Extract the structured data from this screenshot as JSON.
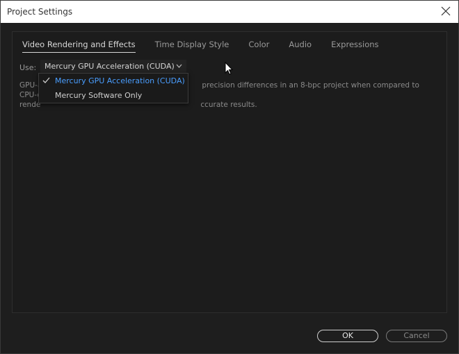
{
  "window": {
    "title": "Project Settings"
  },
  "tabs": [
    {
      "label": "Video Rendering and Effects",
      "active": true
    },
    {
      "label": "Time Display Style",
      "active": false
    },
    {
      "label": "Color",
      "active": false
    },
    {
      "label": "Audio",
      "active": false
    },
    {
      "label": "Expressions",
      "active": false
    }
  ],
  "renderer": {
    "use_label": "Use:",
    "selected": "Mercury GPU Acceleration (CUDA)",
    "options": [
      "Mercury GPU Acceleration (CUDA)",
      "Mercury Software Only"
    ],
    "description_line1_start": "GPU-a",
    "description_line1_end": "precision differences in an 8-bpc project when compared to CPU-only",
    "description_line2_start": "rende",
    "description_line2_end": "ccurate results."
  },
  "buttons": {
    "ok": "OK",
    "cancel": "Cancel"
  },
  "colors": {
    "accent": "#4a9eff",
    "background": "#1e1e1e"
  }
}
